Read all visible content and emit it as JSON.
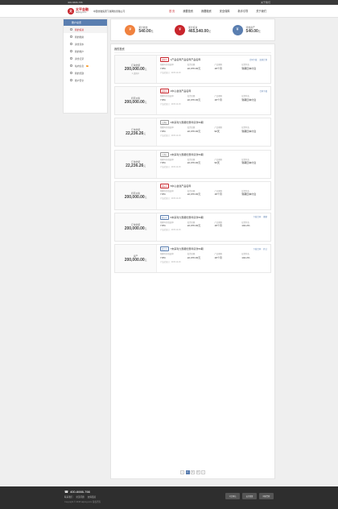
{
  "topbar": {
    "phone": "400-6666-766",
    "right_label": "关于我们"
  },
  "header": {
    "brand": "太平金融",
    "brand_sub": "taiping.com",
    "slogan": "中国金融集团下属网络金融公司",
    "nav": [
      "首 页",
      "我要投资",
      "我要融资",
      "安全保障",
      "新手引导",
      "关于我们"
    ]
  },
  "sidebar": {
    "title": "账户总览",
    "items": [
      {
        "label": "我的投资"
      },
      {
        "label": "我的融资"
      },
      {
        "label": "资金流水"
      },
      {
        "label": "我的账户"
      },
      {
        "label": "资金记录"
      },
      {
        "label": "站内信息",
        "badge": "3"
      },
      {
        "label": "我的奖励"
      },
      {
        "label": "账户安全"
      }
    ]
  },
  "summary": [
    {
      "label": "累计收益",
      "value": "540.00",
      "unit": "元",
      "color": "#f0823f"
    },
    {
      "label": "累计投资",
      "value": "465,540.00",
      "unit": "元",
      "color": "#c8252c"
    },
    {
      "label": "待收资产",
      "value": "540.00",
      "unit": "元",
      "color": "#5a7eb0"
    }
  ],
  "list_title": "我的投资",
  "col_labels": {
    "rate": "预期年化收益率",
    "amount": "投资金额",
    "term": "产品期限",
    "status": "投资状态",
    "date": "产品起息日"
  },
  "cards": [
    {
      "t": "订单金额",
      "a": "200,000.00",
      "d": "1 还款中",
      "tag": "还款中",
      "tc": "",
      "name": "1产品名称产品名称产品名称",
      "rate": "7.8%",
      "amount": "22,076.93元",
      "term": "18个月",
      "status": "到期还本付息",
      "date": "2015-12-03",
      "links": [
        "合同下载",
        "还款计划"
      ]
    },
    {
      "t": "持有价格",
      "a": "200,000.00",
      "d": "",
      "tag": "还款中",
      "tc": "",
      "name": "2中心金钱产品名称",
      "rate": "7.8%",
      "amount": "22,076.93元",
      "term": "18个月",
      "status": "到期还本付息",
      "date": "2015-12-03",
      "links": [
        "合同下载"
      ]
    },
    {
      "t": "订单金额",
      "a": "22,236.26",
      "d": "",
      "tag": "已满标",
      "tc": "g",
      "name": "3未来利九惠都优惠呼贷款56期",
      "rate": "7.8%",
      "amount": "22,076.93元",
      "term": "90天",
      "status": "到期还本付息",
      "date": "2015-12-03",
      "links": []
    },
    {
      "t": "订单金额",
      "a": "22,236.26",
      "d": "",
      "tag": "已满标",
      "tc": "g",
      "name": "4未来利九惠都优惠呼贷款56期",
      "rate": "7.8%",
      "amount": "22,076.93元",
      "term": "90天",
      "status": "到期还本付息",
      "date": "2015-12-03",
      "links": []
    },
    {
      "t": "持有价格",
      "a": "200,000.00",
      "d": "",
      "tag": "投标中",
      "tc": "",
      "name": "5中心金钱产品名称",
      "rate": "7.8%",
      "amount": "22,076.93元",
      "term": "18个月",
      "status": "到期还本付息",
      "date": "2015-12-03",
      "links": []
    },
    {
      "t": "订单金额",
      "a": "200,000.00",
      "d": "",
      "tag": "转让中",
      "tc": "b",
      "name": "6未来利九惠都优惠呼贷款56期",
      "rate": "7.8%",
      "amount": "22,076.93元",
      "term": "18个月",
      "status": "102.2%",
      "date": "2015-12-03",
      "links": [
        "下载合同",
        "撤销"
      ]
    },
    {
      "t": "资产",
      "a": "200,000.00",
      "d": "",
      "tag": "转让中",
      "tc": "b",
      "name": "7未来利九惠都优惠呼贷款56期",
      "rate": "7.8%",
      "amount": "22,076.93元",
      "term": "18个月",
      "status": "102.2%",
      "date": "2015-12-03",
      "links": [
        "下载合同",
        "转让"
      ]
    }
  ],
  "pager": [
    "‹",
    "1",
    "2",
    "3",
    "›"
  ],
  "footer": {
    "phone": "400-6666-766",
    "links": [
      "联系我们",
      "常见问题",
      "友情链接"
    ],
    "copy": "Copyright © 2015 taiping.com 版权所有",
    "badges": [
      "可信网站",
      "安全联盟",
      "网络警察"
    ]
  }
}
